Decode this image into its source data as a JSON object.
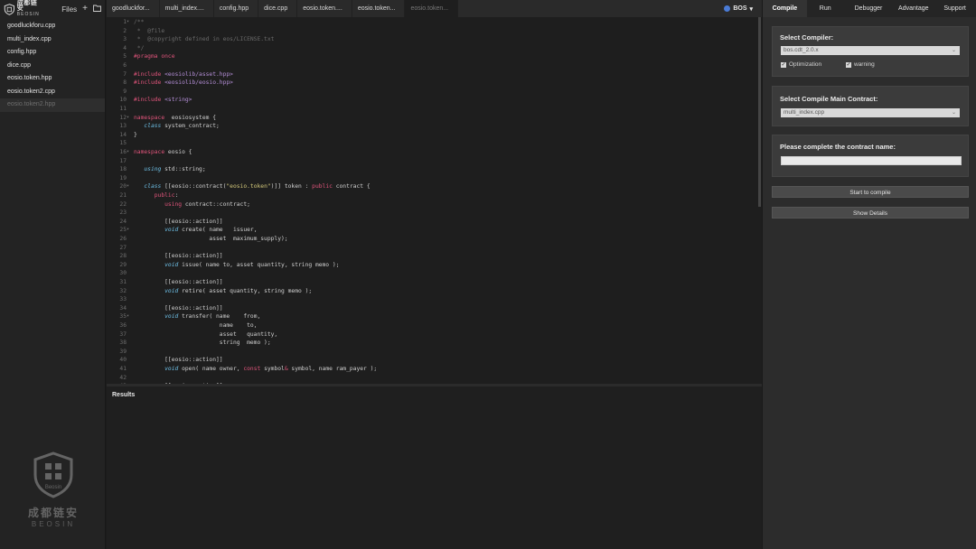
{
  "sidebar": {
    "logo_cn": "成都链安",
    "logo_en": "BEOSIN",
    "files_label": "Files",
    "add_icon": "+",
    "folder_icon": "folder-icon",
    "files": [
      {
        "name": "goodluckforu.cpp",
        "active": false
      },
      {
        "name": "multi_index.cpp",
        "active": false
      },
      {
        "name": "config.hpp",
        "active": false
      },
      {
        "name": "dice.cpp",
        "active": false
      },
      {
        "name": "eosio.token.hpp",
        "active": false
      },
      {
        "name": "eosio.token2.cpp",
        "active": false
      },
      {
        "name": "eosio.token2.hpp",
        "active": true
      }
    ],
    "watermark_cn": "成都链安",
    "watermark_en": "BEOSIN",
    "watermark_badge": "Beosin"
  },
  "tabs": [
    {
      "label": "goodluckfor...",
      "active": false
    },
    {
      "label": "multi_index....",
      "active": false
    },
    {
      "label": "config.hpp",
      "active": false
    },
    {
      "label": "dice.cpp",
      "active": false
    },
    {
      "label": "eosio.token....",
      "active": false
    },
    {
      "label": "eosio.token...",
      "active": false
    },
    {
      "label": "eosio.token...",
      "active": true
    }
  ],
  "network": {
    "label": "BOS",
    "arrow": "▾"
  },
  "code_lines": [
    [
      [
        "c-com",
        "/**"
      ]
    ],
    [
      [
        "c-com",
        " *  @file"
      ]
    ],
    [
      [
        "c-com",
        " *  @copyright defined in eos/LICENSE.txt"
      ]
    ],
    [
      [
        "c-com",
        " */"
      ]
    ],
    [
      [
        "c-pp",
        "#pragma once"
      ]
    ],
    [],
    [
      [
        "c-pp",
        "#include "
      ],
      [
        "c-inc",
        "<eosiolib/asset.hpp>"
      ]
    ],
    [
      [
        "c-pp",
        "#include "
      ],
      [
        "c-inc",
        "<eosiolib/eosio.hpp>"
      ]
    ],
    [],
    [
      [
        "c-pp",
        "#include "
      ],
      [
        "c-inc",
        "<string>"
      ]
    ],
    [],
    [
      [
        "c-kw",
        "namespace"
      ],
      [
        "",
        "  eosiosystem {"
      ]
    ],
    [
      [
        "",
        "   "
      ],
      [
        "c-ty",
        "class"
      ],
      [
        "",
        " system_contract;"
      ]
    ],
    [
      [
        "",
        "}"
      ]
    ],
    [],
    [
      [
        "c-kw",
        "namespace"
      ],
      [
        "",
        " eosio {"
      ]
    ],
    [],
    [
      [
        "",
        "   "
      ],
      [
        "c-ty",
        "using"
      ],
      [
        "",
        " std::string;"
      ]
    ],
    [],
    [
      [
        "",
        "   "
      ],
      [
        "c-ty",
        "class"
      ],
      [
        "",
        " [[eosio::contract("
      ],
      [
        "c-str",
        "\"eosio.token\""
      ],
      [
        "",
        ")]] token : "
      ],
      [
        "c-kw",
        "public"
      ],
      [
        "",
        " contract {"
      ]
    ],
    [
      [
        "",
        "      "
      ],
      [
        "c-kw",
        "public"
      ],
      [
        "",
        ":"
      ]
    ],
    [
      [
        "",
        "         "
      ],
      [
        "c-kw",
        "using"
      ],
      [
        "",
        " contract::contract;"
      ]
    ],
    [],
    [
      [
        "",
        "         [[eosio::action]]"
      ]
    ],
    [
      [
        "",
        "         "
      ],
      [
        "c-ty",
        "void"
      ],
      [
        "",
        " create( name   issuer,"
      ]
    ],
    [
      [
        "",
        "                      asset  maximum_supply);"
      ]
    ],
    [],
    [
      [
        "",
        "         [[eosio::action]]"
      ]
    ],
    [
      [
        "",
        "         "
      ],
      [
        "c-ty",
        "void"
      ],
      [
        "",
        " issue( name to, asset quantity, string memo );"
      ]
    ],
    [],
    [
      [
        "",
        "         [[eosio::action]]"
      ]
    ],
    [
      [
        "",
        "         "
      ],
      [
        "c-ty",
        "void"
      ],
      [
        "",
        " retire( asset quantity, string memo );"
      ]
    ],
    [],
    [
      [
        "",
        "         [[eosio::action]]"
      ]
    ],
    [
      [
        "",
        "         "
      ],
      [
        "c-ty",
        "void"
      ],
      [
        "",
        " transfer( name    from,"
      ]
    ],
    [
      [
        "",
        "                         name    to,"
      ]
    ],
    [
      [
        "",
        "                         asset   quantity,"
      ]
    ],
    [
      [
        "",
        "                         string  memo );"
      ]
    ],
    [],
    [
      [
        "",
        "         [[eosio::action]]"
      ]
    ],
    [
      [
        "",
        "         "
      ],
      [
        "c-ty",
        "void"
      ],
      [
        "",
        " open( name owner, "
      ],
      [
        "c-kw",
        "const"
      ],
      [
        "",
        " symbol"
      ],
      [
        "c-kw",
        "&"
      ],
      [
        "",
        " symbol, name ram_payer );"
      ]
    ],
    [],
    [
      [
        "",
        "         [[eosio::action]]"
      ]
    ]
  ],
  "fold_lines": [
    1,
    12,
    16,
    20,
    25,
    35
  ],
  "results": {
    "title": "Results"
  },
  "right_panel": {
    "tabs": [
      {
        "label": "Compile",
        "active": true
      },
      {
        "label": "Run",
        "active": false
      },
      {
        "label": "Debugger",
        "active": false
      },
      {
        "label": "Advantage",
        "active": false
      },
      {
        "label": "Support",
        "active": false
      }
    ],
    "compiler": {
      "title": "Select Compiler:",
      "value": "bos.cdt_2.0.x",
      "optimization_label": "Optimization",
      "warning_label": "warning",
      "check_mark": "✓"
    },
    "main_contract": {
      "title": "Select Compile Main Contract:",
      "value": "multi_index.cpp"
    },
    "contract_name": {
      "title": "Please complete the contract name:",
      "value": ""
    },
    "start_button": "Start to compile",
    "details_button": "Show Details",
    "select_arrow": "⌄"
  }
}
